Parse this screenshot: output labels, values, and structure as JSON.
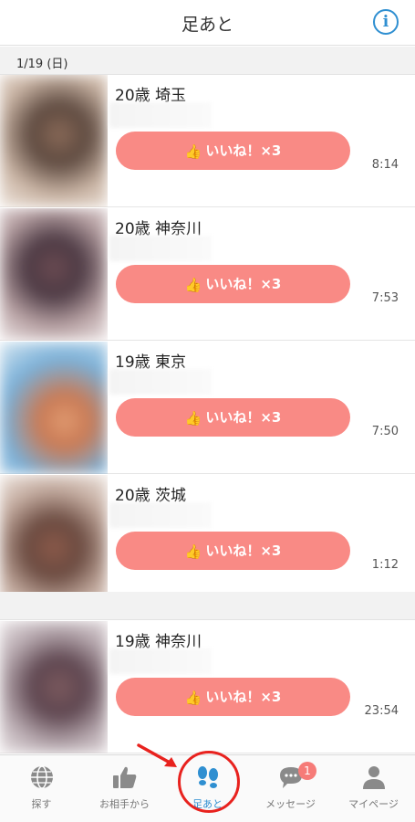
{
  "header": {
    "title": "足あと",
    "info_icon": "info-icon"
  },
  "date_header": "1/19 (日)",
  "rows": [
    {
      "title": "20歳 埼玉",
      "like_label": "いいね！×3",
      "time": "8:14"
    },
    {
      "title": "20歳 神奈川",
      "like_label": "いいね！×3",
      "time": "7:53"
    },
    {
      "title": "19歳 東京",
      "like_label": "いいね！×3",
      "time": "7:50"
    },
    {
      "title": "20歳 茨城",
      "like_label": "いいね！×3",
      "time": "1:12"
    },
    {
      "title": "19歳 神奈川",
      "like_label": "いいね！×3",
      "time": "23:54"
    }
  ],
  "tabs": [
    {
      "label": "探す",
      "icon": "globe-icon"
    },
    {
      "label": "お相手から",
      "icon": "thumbs-up-icon"
    },
    {
      "label": "足あと",
      "icon": "footprints-icon",
      "active": true
    },
    {
      "label": "メッセージ",
      "icon": "chat-bubble-icon",
      "badge": "1"
    },
    {
      "label": "マイページ",
      "icon": "person-icon"
    }
  ],
  "colors": {
    "accent": "#2f8fd1",
    "like_button": "#f98a85",
    "annotation": "#e8221e"
  }
}
